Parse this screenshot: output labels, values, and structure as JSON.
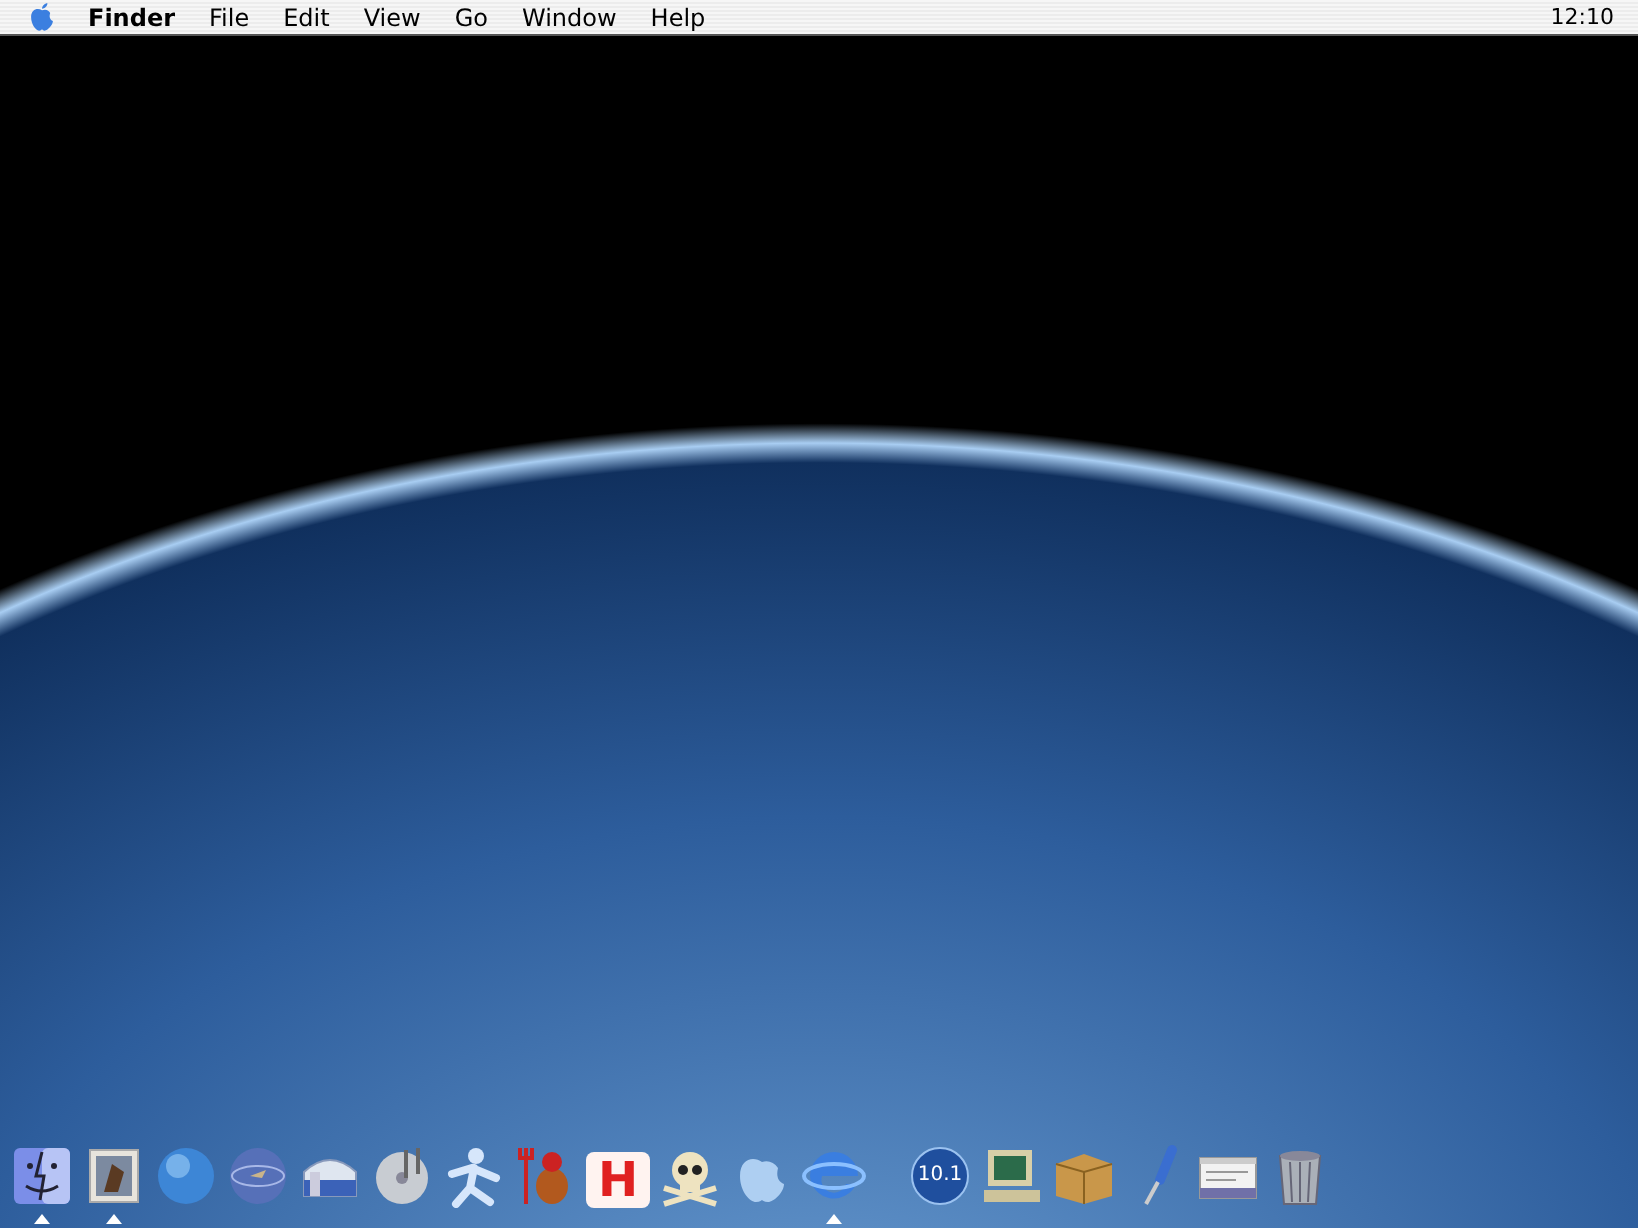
{
  "menu_bar": {
    "items": [
      {
        "label": "Finder",
        "bold": true
      },
      {
        "label": "File",
        "bold": false
      },
      {
        "label": "Edit",
        "bold": false
      },
      {
        "label": "View",
        "bold": false
      },
      {
        "label": "Go",
        "bold": false
      },
      {
        "label": "Window",
        "bold": false
      },
      {
        "label": "Help",
        "bold": false
      }
    ],
    "clock": "12:10"
  },
  "dock": {
    "sections": [
      {
        "items": [
          {
            "kind": "finder",
            "running": true
          },
          {
            "kind": "stamp",
            "running": true
          },
          {
            "kind": "globe",
            "running": false
          },
          {
            "kind": "orb",
            "running": false
          },
          {
            "kind": "drive",
            "running": false
          },
          {
            "kind": "cd",
            "running": false
          },
          {
            "kind": "person",
            "running": false
          },
          {
            "kind": "devil",
            "running": false
          },
          {
            "kind": "letter",
            "running": false,
            "text": "H"
          },
          {
            "kind": "skull",
            "running": false
          },
          {
            "kind": "apple",
            "running": false
          },
          {
            "kind": "browser",
            "running": true
          }
        ]
      },
      {
        "items": [
          {
            "kind": "disc",
            "running": false,
            "text": "10.1"
          },
          {
            "kind": "computer",
            "running": false
          },
          {
            "kind": "box",
            "running": false
          },
          {
            "kind": "screwdriver",
            "running": false
          },
          {
            "kind": "window",
            "running": false
          },
          {
            "kind": "trash",
            "running": false
          }
        ]
      }
    ]
  }
}
